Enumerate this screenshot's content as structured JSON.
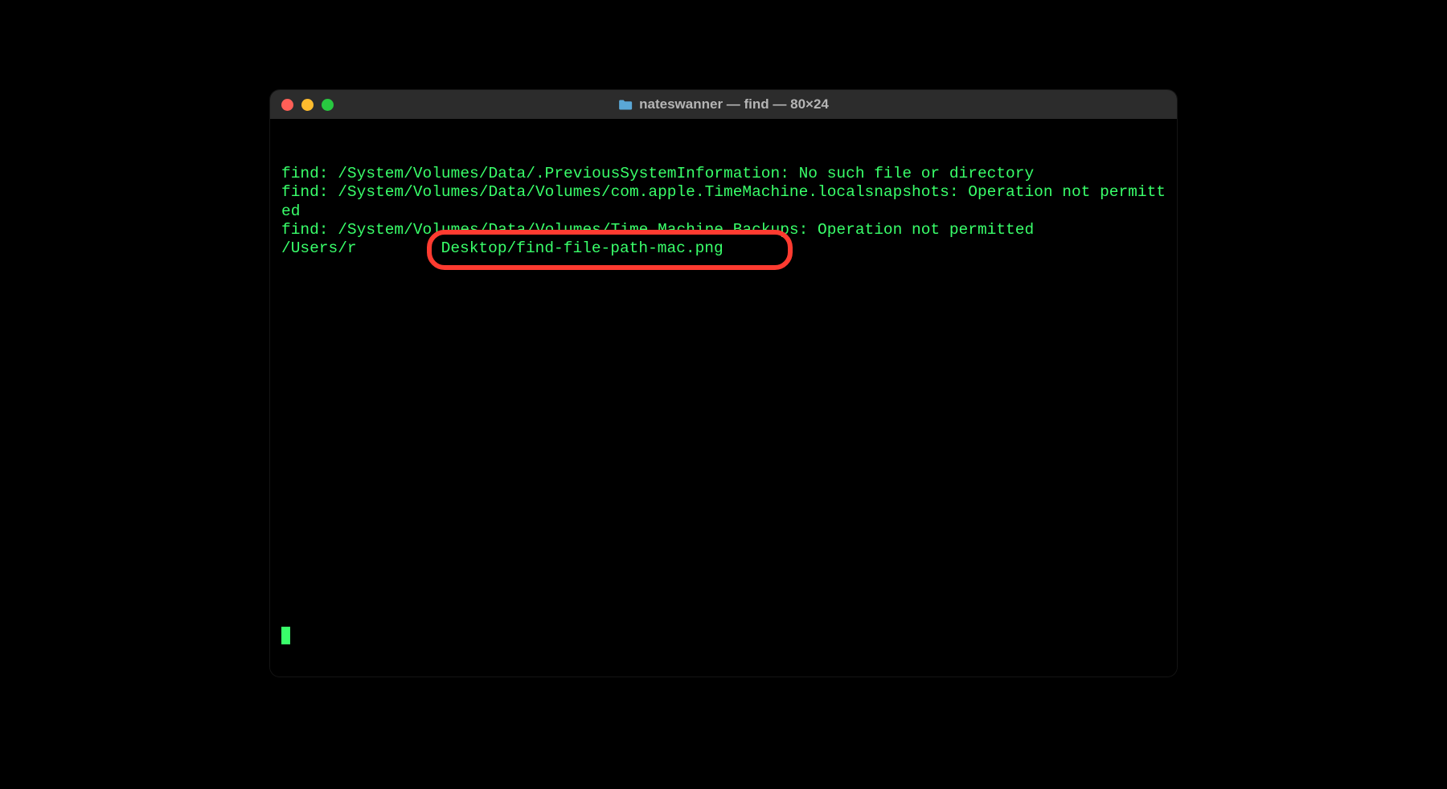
{
  "window": {
    "title": "nateswanner — find — 80×24"
  },
  "terminal": {
    "lines": {
      "line1": "find: /System/Volumes/Data/.PreviousSystemInformation: No such file or directory",
      "line2": "find: /System/Volumes/Data/Volumes/com.apple.TimeMachine.localsnapshots: Operation not permitted",
      "line3": "find: /System/Volumes/Data/Volumes/Time Machine Backups: Operation not permitted",
      "line4_prefix": "/Users/r",
      "line4_highlighted": "Desktop/find-file-path-mac.png"
    }
  },
  "colors": {
    "terminal_text": "#39ff6a",
    "annotation": "#ff3b30"
  }
}
